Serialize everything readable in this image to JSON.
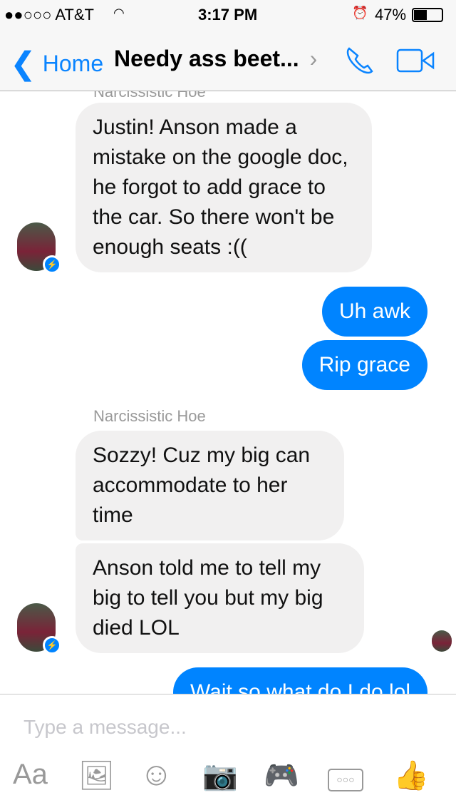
{
  "status_bar": {
    "carrier": "●●○○○ AT&T",
    "time": "3:17 PM",
    "battery": "47%"
  },
  "nav": {
    "back_label": "Home",
    "title": "Needy ass beet...",
    "chevron": "›"
  },
  "colors": {
    "accent": "#0084ff",
    "incoming_bubble": "#f1f0f0"
  },
  "messages": [
    {
      "from": "other",
      "text": "Justin! Anson made a mistake on the google doc, he forgot to add grace to the car. So there won't be enough seats :(("
    },
    {
      "from": "me",
      "text": "Uh awk"
    },
    {
      "from": "me",
      "text": "Rip grace"
    },
    {
      "from": "other",
      "sender": "Narcissistic Hoe",
      "text": "Sozzy! Cuz my big can accommodate to her time"
    },
    {
      "from": "other",
      "text": "Anson told me to tell my big to tell you but my big died LOL"
    },
    {
      "from": "me",
      "text": "Wait so what do I do lol"
    }
  ],
  "top_sender": "Narcissistic Hoe",
  "composer": {
    "placeholder": "Type a message...",
    "text_button": "Aa"
  }
}
